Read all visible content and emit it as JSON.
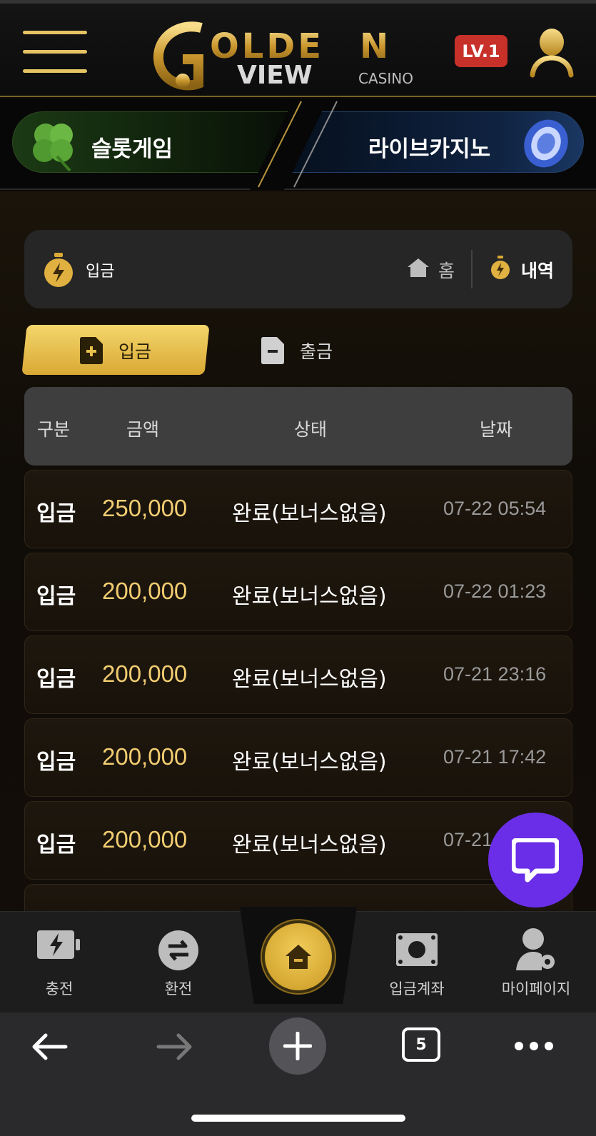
{
  "header": {
    "logo_text": "GOLDEN VIEW CASINO",
    "level_badge": "LV.1"
  },
  "game_banner": {
    "left_label": "슬롯게임",
    "right_label": "라이브카지노"
  },
  "page_head": {
    "title": "입금",
    "breadcrumb_home": "홈",
    "breadcrumb_history": "내역"
  },
  "tabs": {
    "deposit": "입금",
    "withdraw": "출금"
  },
  "table": {
    "headers": [
      "구분",
      "금액",
      "상태",
      "날짜"
    ],
    "rows": [
      {
        "type": "입금",
        "amount": "250,000",
        "status": "완료(보너스없음)",
        "date": "07-22 05:54"
      },
      {
        "type": "입금",
        "amount": "200,000",
        "status": "완료(보너스없음)",
        "date": "07-22 01:23"
      },
      {
        "type": "입금",
        "amount": "200,000",
        "status": "완료(보너스없음)",
        "date": "07-21 23:16"
      },
      {
        "type": "입금",
        "amount": "200,000",
        "status": "완료(보너스없음)",
        "date": "07-21 17:42"
      },
      {
        "type": "입금",
        "amount": "200,000",
        "status": "완료(보너스없음)",
        "date": "07-21"
      }
    ]
  },
  "bottom_nav": {
    "items": [
      "충전",
      "환전",
      "입금계좌",
      "마이페이지"
    ]
  },
  "browser": {
    "tab_count": "5"
  },
  "colors": {
    "gold": "#f2cd71",
    "accent_purple": "#6a2ee8",
    "badge_red": "#c8302a"
  }
}
